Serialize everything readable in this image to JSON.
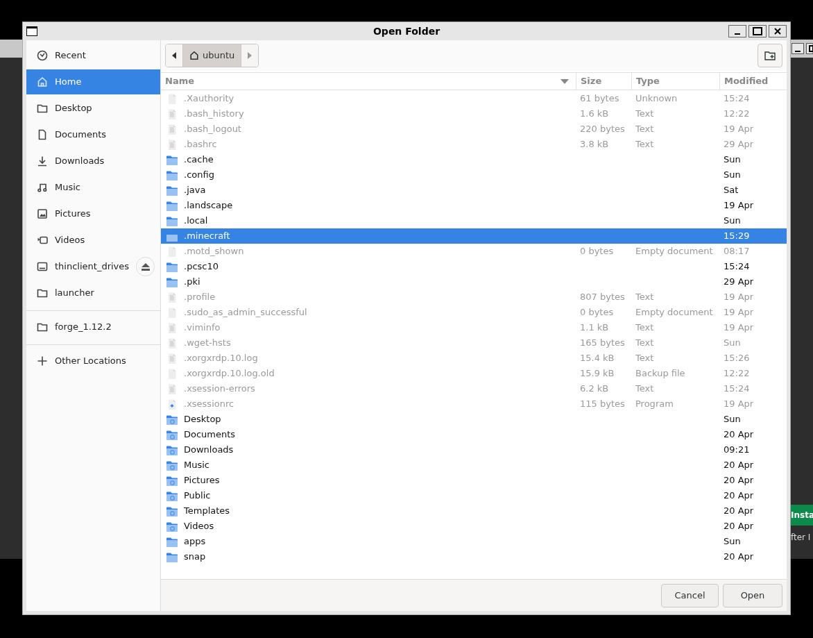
{
  "background_window": {
    "button": "Insta",
    "note": "fter I"
  },
  "window": {
    "title": "Open Folder"
  },
  "sidebar": {
    "sections": [
      [
        {
          "label": "Recent",
          "kind": "clock",
          "selected": false
        },
        {
          "label": "Home",
          "kind": "home",
          "selected": true
        },
        {
          "label": "Desktop",
          "kind": "folder",
          "selected": false
        },
        {
          "label": "Documents",
          "kind": "document",
          "selected": false
        },
        {
          "label": "Downloads",
          "kind": "download",
          "selected": false
        },
        {
          "label": "Music",
          "kind": "music",
          "selected": false
        },
        {
          "label": "Pictures",
          "kind": "picture",
          "selected": false
        },
        {
          "label": "Videos",
          "kind": "video",
          "selected": false
        },
        {
          "label": "thinclient_drives",
          "kind": "drive",
          "selected": false,
          "eject": true
        },
        {
          "label": "launcher",
          "kind": "folder",
          "selected": false
        }
      ],
      [
        {
          "label": "forge_1.12.2",
          "kind": "folder",
          "selected": false
        }
      ],
      [
        {
          "label": "Other Locations",
          "kind": "plus",
          "selected": false
        }
      ]
    ]
  },
  "path_bar": {
    "segments": [
      {
        "label": "ubuntu",
        "kind": "home",
        "selected": true
      }
    ]
  },
  "table": {
    "columns": [
      {
        "label": "Name",
        "sorted": true
      },
      {
        "label": "Size",
        "sorted": false
      },
      {
        "label": "Type",
        "sorted": false
      },
      {
        "label": "Modified",
        "sorted": false
      }
    ],
    "rows": [
      {
        "kind": "file",
        "name": ".Xauthority",
        "size": "61 bytes",
        "type": "Unknown",
        "modified": "15:24",
        "disabled": true,
        "selected": false
      },
      {
        "kind": "text",
        "name": ".bash_history",
        "size": "1.6 kB",
        "type": "Text",
        "modified": "12:22",
        "disabled": true,
        "selected": false
      },
      {
        "kind": "text",
        "name": ".bash_logout",
        "size": "220 bytes",
        "type": "Text",
        "modified": "19 Apr",
        "disabled": true,
        "selected": false
      },
      {
        "kind": "text",
        "name": ".bashrc",
        "size": "3.8 kB",
        "type": "Text",
        "modified": "29 Apr",
        "disabled": true,
        "selected": false
      },
      {
        "kind": "folder",
        "name": ".cache",
        "modified": "Sun",
        "disabled": false,
        "selected": false
      },
      {
        "kind": "folder",
        "name": ".config",
        "modified": "Sun",
        "disabled": false,
        "selected": false
      },
      {
        "kind": "folder",
        "name": ".java",
        "modified": "Sat",
        "disabled": false,
        "selected": false
      },
      {
        "kind": "folder",
        "name": ".landscape",
        "modified": "19 Apr",
        "disabled": false,
        "selected": false
      },
      {
        "kind": "folder",
        "name": ".local",
        "modified": "Sun",
        "disabled": false,
        "selected": false
      },
      {
        "kind": "folder",
        "name": ".minecraft",
        "modified": "15:29",
        "disabled": false,
        "selected": true
      },
      {
        "kind": "file",
        "name": ".motd_shown",
        "size": "0 bytes",
        "type": "Empty document",
        "modified": "08:17",
        "disabled": true,
        "selected": false
      },
      {
        "kind": "folder",
        "name": ".pcsc10",
        "modified": "15:24",
        "disabled": false,
        "selected": false
      },
      {
        "kind": "folder",
        "name": ".pki",
        "modified": "29 Apr",
        "disabled": false,
        "selected": false
      },
      {
        "kind": "text",
        "name": ".profile",
        "size": "807 bytes",
        "type": "Text",
        "modified": "19 Apr",
        "disabled": true,
        "selected": false
      },
      {
        "kind": "file",
        "name": ".sudo_as_admin_successful",
        "size": "0 bytes",
        "type": "Empty document",
        "modified": "19 Apr",
        "disabled": true,
        "selected": false
      },
      {
        "kind": "text",
        "name": ".viminfo",
        "size": "1.1 kB",
        "type": "Text",
        "modified": "19 Apr",
        "disabled": true,
        "selected": false
      },
      {
        "kind": "text",
        "name": ".wget-hsts",
        "size": "165 bytes",
        "type": "Text",
        "modified": "Sun",
        "disabled": true,
        "selected": false
      },
      {
        "kind": "text",
        "name": ".xorgxrdp.10.log",
        "size": "15.4 kB",
        "type": "Text",
        "modified": "15:26",
        "disabled": true,
        "selected": false
      },
      {
        "kind": "file",
        "name": ".xorgxrdp.10.log.old",
        "size": "15.9 kB",
        "type": "Backup file",
        "modified": "12:22",
        "disabled": true,
        "selected": false
      },
      {
        "kind": "text",
        "name": ".xsession-errors",
        "size": "6.2 kB",
        "type": "Text",
        "modified": "15:24",
        "disabled": true,
        "selected": false
      },
      {
        "kind": "program",
        "name": ".xsessionrc",
        "size": "115 bytes",
        "type": "Program",
        "modified": "19 Apr",
        "disabled": true,
        "selected": false
      },
      {
        "kind": "special_folder",
        "name": "Desktop",
        "modified": "Sun",
        "disabled": false,
        "selected": false
      },
      {
        "kind": "special_folder",
        "name": "Documents",
        "modified": "20 Apr",
        "disabled": false,
        "selected": false
      },
      {
        "kind": "special_folder",
        "name": "Downloads",
        "modified": "09:21",
        "disabled": false,
        "selected": false
      },
      {
        "kind": "special_folder",
        "name": "Music",
        "modified": "20 Apr",
        "disabled": false,
        "selected": false
      },
      {
        "kind": "special_folder",
        "name": "Pictures",
        "modified": "20 Apr",
        "disabled": false,
        "selected": false
      },
      {
        "kind": "special_folder",
        "name": "Public",
        "modified": "20 Apr",
        "disabled": false,
        "selected": false
      },
      {
        "kind": "special_folder",
        "name": "Templates",
        "modified": "20 Apr",
        "disabled": false,
        "selected": false
      },
      {
        "kind": "special_folder",
        "name": "Videos",
        "modified": "20 Apr",
        "disabled": false,
        "selected": false
      },
      {
        "kind": "folder",
        "name": "apps",
        "modified": "Sun",
        "disabled": false,
        "selected": false
      },
      {
        "kind": "folder",
        "name": "snap",
        "modified": "20 Apr",
        "disabled": false,
        "selected": false
      }
    ]
  },
  "buttons": [
    "Cancel",
    "Open"
  ]
}
